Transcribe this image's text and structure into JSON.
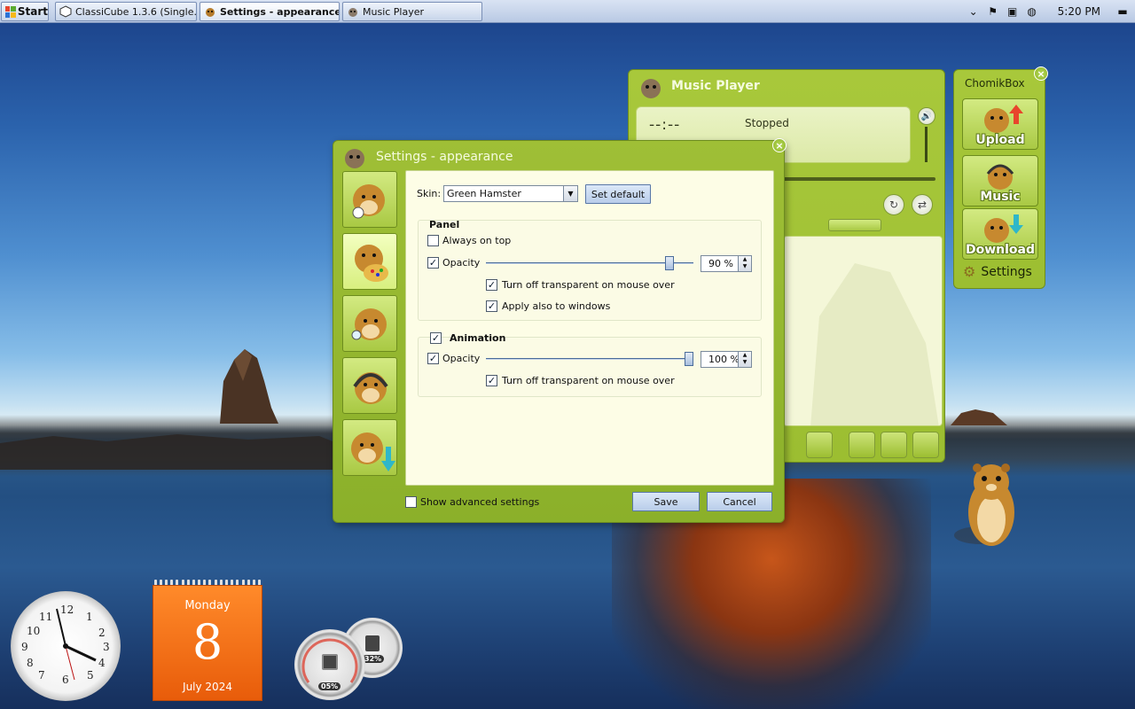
{
  "taskbar": {
    "start_label": "Start",
    "tasks": [
      {
        "label": "ClassiCube 1.3.6 (Single..."
      },
      {
        "label": "Settings - appearance"
      },
      {
        "label": "Music Player"
      }
    ],
    "clock": "5:20 PM"
  },
  "settings_dialog": {
    "title": "Settings - appearance",
    "skin_label": "Skin:",
    "skin_value": "Green Hamster",
    "set_default_label": "Set default",
    "panel_group": {
      "title": "Panel",
      "always_on_top_label": "Always on top",
      "always_on_top_checked": false,
      "opacity_label": "Opacity",
      "opacity_checked": true,
      "opacity_value": "90 %",
      "opacity_level": 0.9,
      "turn_off_transparent_label": "Turn off transparent on mouse over",
      "turn_off_transparent_checked": true,
      "apply_windows_label": "Apply also to windows",
      "apply_windows_checked": true
    },
    "animation_group": {
      "title": "Animation",
      "title_checked": true,
      "opacity_label": "Opacity",
      "opacity_checked": true,
      "opacity_value": "100 %",
      "opacity_level": 1.0,
      "turn_off_transparent_label": "Turn off transparent on mouse over",
      "turn_off_transparent_checked": true
    },
    "show_advanced_label": "Show advanced settings",
    "show_advanced_checked": false,
    "save_label": "Save",
    "cancel_label": "Cancel"
  },
  "music_player": {
    "title": "Music Player",
    "time": "--:--",
    "status": "Stopped"
  },
  "chomikbox": {
    "title": "ChomikBox",
    "upload_label": "Upload",
    "music_label": "Music",
    "download_label": "Download",
    "settings_label": "Settings"
  },
  "calendar": {
    "day": "Monday",
    "date": "8",
    "month": "July 2024"
  },
  "cpu_meter": {
    "cpu": "05%",
    "memory": "32%"
  },
  "colors": {
    "skin_green": "#9cbe31",
    "calendar_orange": "#f07016"
  },
  "icons": {
    "close": "close-icon",
    "hamster": "hamster-icon",
    "volume": "volume-icon"
  }
}
